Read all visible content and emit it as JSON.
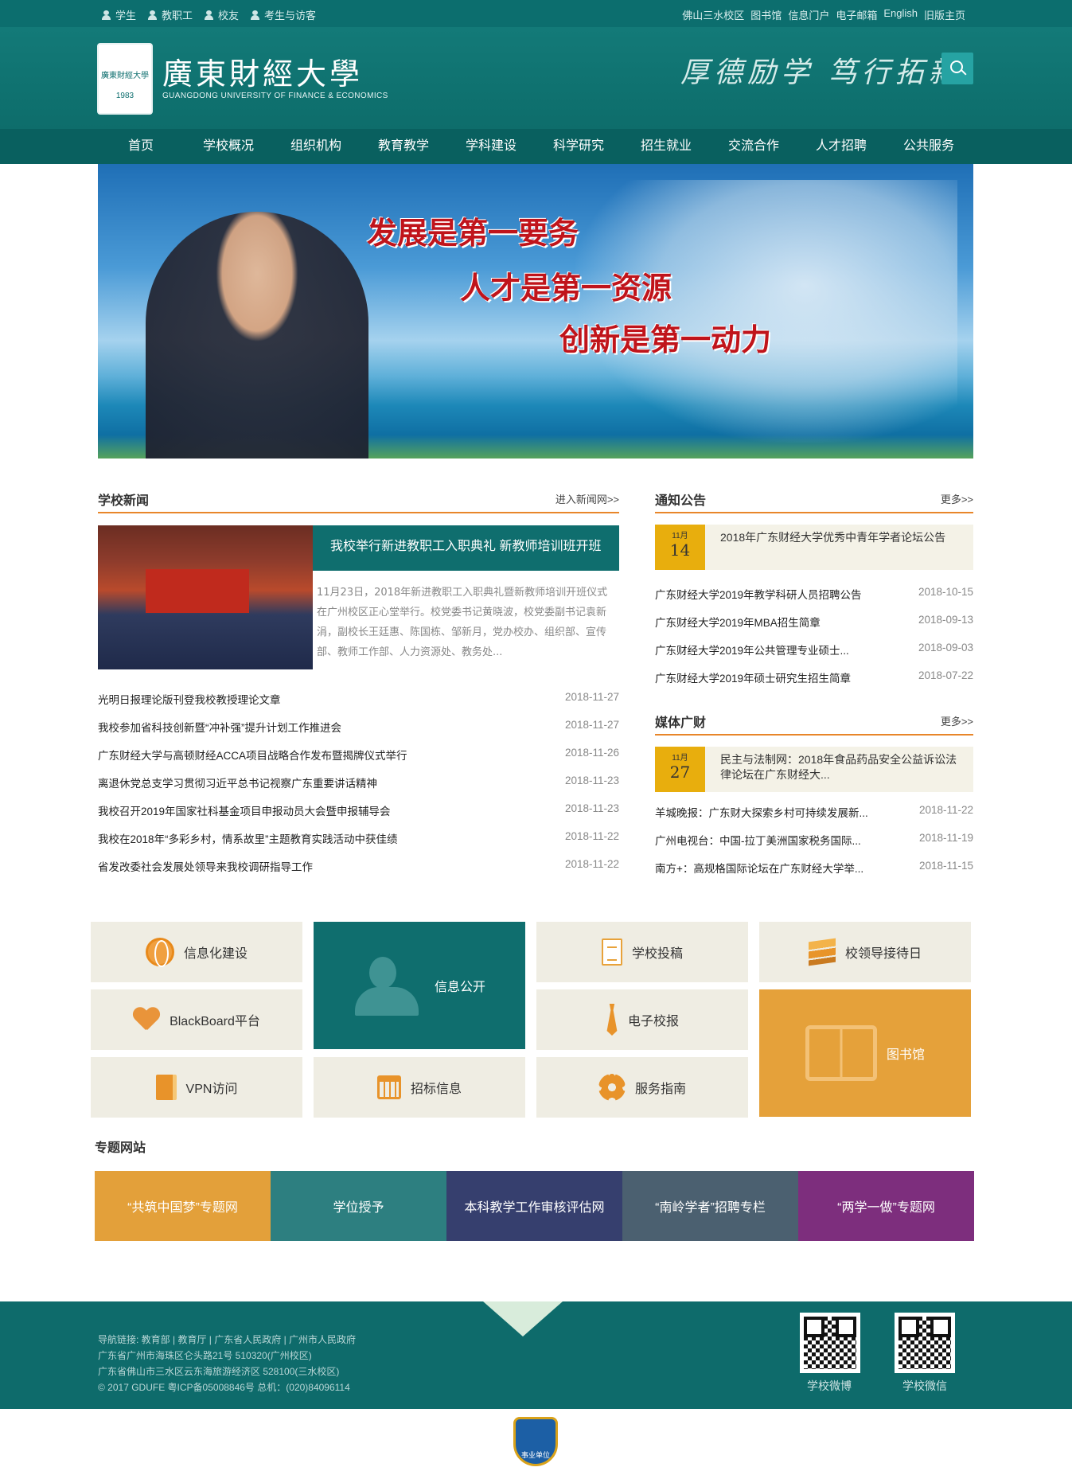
{
  "topbar": {
    "left": [
      "学生",
      "教职工",
      "校友",
      "考生与访客"
    ],
    "right": [
      "佛山三水校区",
      "图书馆",
      "信息门户",
      "电子邮箱",
      "English",
      "旧版主页"
    ]
  },
  "header": {
    "name_cn": "廣東財經大學",
    "name_en": "GUANGDONG UNIVERSITY OF FINANCE & ECONOMICS",
    "motto": "厚德励学 笃行拓新",
    "logo_text": "廣東財經大學",
    "logo_year": "1983"
  },
  "nav": [
    "首页",
    "学校概况",
    "组织机构",
    "教育教学",
    "学科建设",
    "科学研究",
    "招生就业",
    "交流合作",
    "人才招聘",
    "公共服务"
  ],
  "banner": {
    "slogans": [
      "发展是第一要务",
      "人才是第一资源",
      "创新是第一动力"
    ]
  },
  "news": {
    "title": "学校新闻",
    "more": "进入新闻网>>",
    "featured_title": "我校举行新进教职工入职典礼 新教师培训班开班",
    "featured_desc": "11月23日，2018年新进教职工入职典礼暨新教师培训开班仪式在广州校区正心堂举行。校党委书记黄晓波，校党委副书记袁新涓，副校长王廷惠、陈国栋、邹新月，党办校办、组织部、宣传部、教师工作部、人力资源处、教务处...",
    "items": [
      {
        "title": "光明日报理论版刊登我校教授理论文章",
        "date": "2018-11-27"
      },
      {
        "title": "我校参加省科技创新暨“冲补强”提升计划工作推进会",
        "date": "2018-11-27"
      },
      {
        "title": "广东财经大学与高顿财经ACCA项目战略合作发布暨揭牌仪式举行",
        "date": "2018-11-26"
      },
      {
        "title": "离退休党总支学习贯彻习近平总书记视察广东重要讲话精神",
        "date": "2018-11-23"
      },
      {
        "title": "我校召开2019年国家社科基金项目申报动员大会暨申报辅导会",
        "date": "2018-11-23"
      },
      {
        "title": "我校在2018年“多彩乡村，情系故里”主题教育实践活动中获佳绩",
        "date": "2018-11-22"
      },
      {
        "title": "省发改委社会发展处领导来我校调研指导工作",
        "date": "2018-11-22"
      }
    ]
  },
  "notice": {
    "title": "通知公告",
    "more": "更多>>",
    "top": {
      "month": "11月",
      "day": "14",
      "title": "2018年广东财经大学优秀中青年学者论坛公告"
    },
    "items": [
      {
        "title": "广东财经大学2019年教学科研人员招聘公告",
        "date": "2018-10-15"
      },
      {
        "title": "广东财经大学2019年MBA招生简章",
        "date": "2018-09-13"
      },
      {
        "title": "广东财经大学2019年公共管理专业硕士...",
        "date": "2018-09-03"
      },
      {
        "title": "广东财经大学2019年硕士研究生招生简章",
        "date": "2018-07-22"
      }
    ]
  },
  "media": {
    "title": "媒体广财",
    "more": "更多>>",
    "top": {
      "month": "11月",
      "day": "27",
      "title": "民主与法制网：2018年食品药品安全公益诉讼法律论坛在广东财经大..."
    },
    "items": [
      {
        "title": "羊城晚报：广东财大探索乡村可持续发展新...",
        "date": "2018-11-22"
      },
      {
        "title": "广州电视台：中国-拉丁美洲国家税务国际...",
        "date": "2018-11-19"
      },
      {
        "title": "南方+：高规格国际论坛在广东财经大学举...",
        "date": "2018-11-15"
      }
    ]
  },
  "tiles": {
    "info_build": "信息化建设",
    "info_open": "信息公开",
    "submit": "学校投稿",
    "reception": "校领导接待日",
    "blackboard": "BlackBoard平台",
    "ecard": "电子校报",
    "library": "图书馆",
    "vpn": "VPN访问",
    "bidding": "招标信息",
    "guide": "服务指南"
  },
  "topics": {
    "title": "专题网站",
    "items": [
      {
        "label": "“共筑中国梦”专题网",
        "color": "#e3a03a"
      },
      {
        "label": "学位授予",
        "color": "#2d7f80"
      },
      {
        "label": "本科教学工作审核评估网",
        "color": "#363f6e"
      },
      {
        "label": "“南岭学者”招聘专栏",
        "color": "#4b6070"
      },
      {
        "label": "“两学一做”专题网",
        "color": "#7d2e7d"
      }
    ]
  },
  "footer": {
    "line1": "导航链接: 教育部 | 教育厅 | 广东省人民政府 | 广州市人民政府",
    "line2": "广东省广州市海珠区仑头路21号 510320(广州校区)",
    "line3": "广东省佛山市三水区云东海旅游经济区 528100(三水校区)",
    "line4": "© 2017 GDUFE 粤ICP备05008846号 总机：(020)84096114",
    "qr1": "学校微博",
    "qr2": "学校微信",
    "badge": "事业单位"
  }
}
